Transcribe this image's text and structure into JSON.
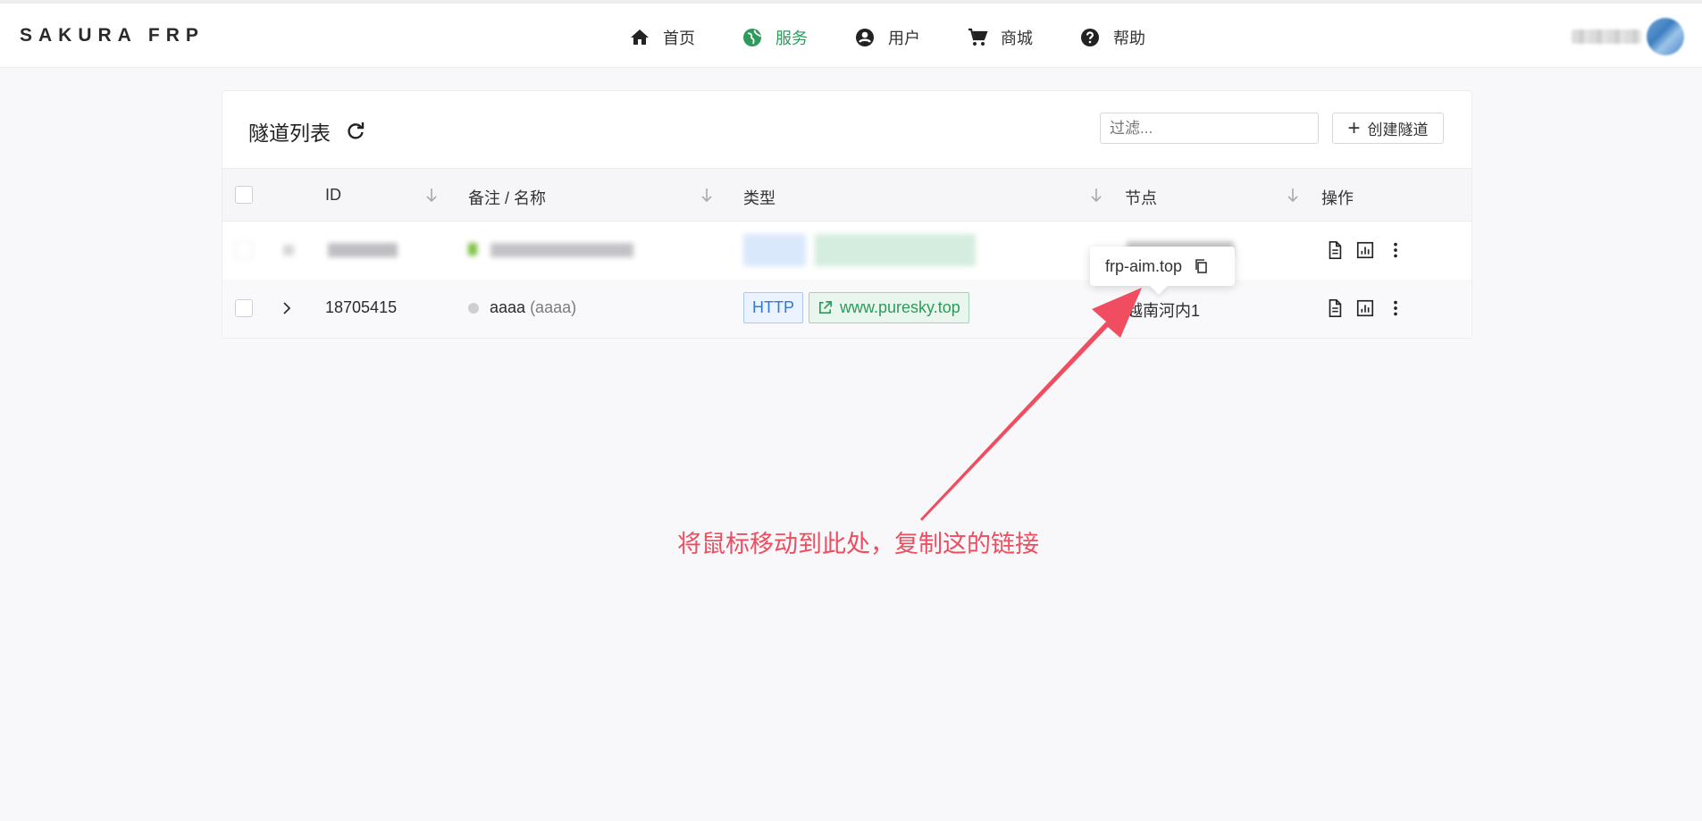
{
  "brand": "SAKURA FRP",
  "nav": [
    {
      "label": "首页",
      "icon": "home-icon"
    },
    {
      "label": "服务",
      "icon": "globe-icon",
      "active": true
    },
    {
      "label": "用户",
      "icon": "account-icon"
    },
    {
      "label": "商城",
      "icon": "cart-icon"
    },
    {
      "label": "帮助",
      "icon": "help-icon"
    }
  ],
  "colors": {
    "accent": "#2e9a5c",
    "annotation": "#ee4d5f",
    "http_tag": "#2f7ad3"
  },
  "card": {
    "title": "隧道列表",
    "filter_placeholder": "过滤...",
    "create_label": "创建隧道"
  },
  "table": {
    "headers": [
      "ID",
      "备注 / 名称",
      "类型",
      "节点",
      "操作"
    ],
    "rows": [
      {
        "blurred": true
      },
      {
        "id": "18705415",
        "name": "aaaa",
        "name_alias": "(aaaa)",
        "type": "HTTP",
        "domain": "www.puresky.top",
        "node": "越南河内1"
      }
    ]
  },
  "tooltip": {
    "text": "frp-aim.top"
  },
  "annotation": "将鼠标移动到此处，复制这的链接"
}
